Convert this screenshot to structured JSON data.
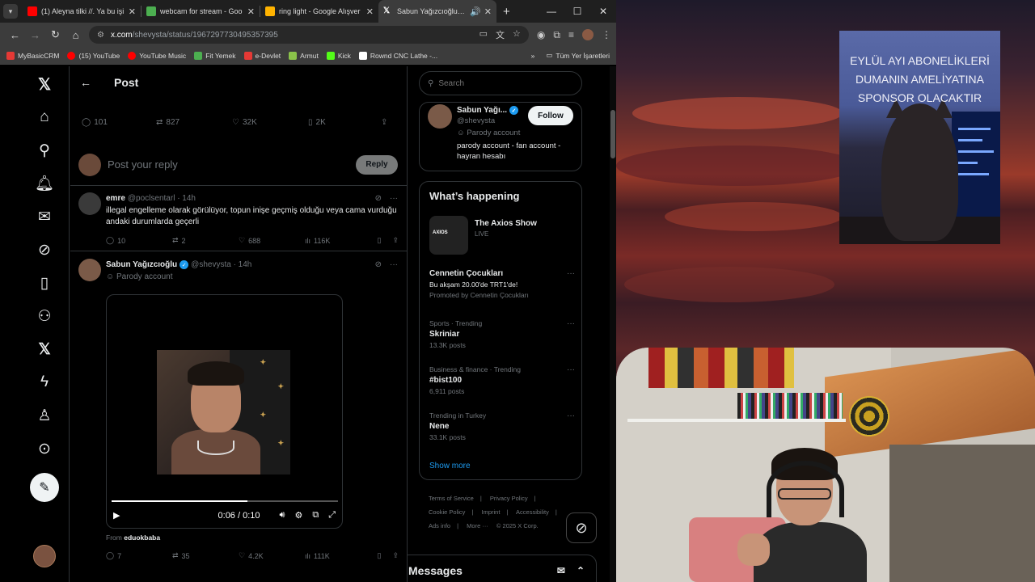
{
  "tabs": [
    {
      "title": "(1) Aleyna tilki //. Ya bu işi",
      "color": "#ff0000",
      "active": false
    },
    {
      "title": "webcam for stream - Goo",
      "color": "#4caf50",
      "active": false
    },
    {
      "title": "ring light - Google Alışver",
      "color": "#ffb300",
      "active": false
    },
    {
      "title": "Sabun Yağızcıoğlu on",
      "color": "#ffffff",
      "active": true
    }
  ],
  "address": {
    "domain": "x.com",
    "path": "/shevysta/status/1967297730495357395"
  },
  "bookmarks": [
    {
      "label": "MyBasicCRM",
      "color": "#e53935"
    },
    {
      "label": "(15) YouTube",
      "color": "#ff0000"
    },
    {
      "label": "YouTube Music",
      "color": "#ff0000"
    },
    {
      "label": "Fit Yemek",
      "color": "#4caf50"
    },
    {
      "label": "e-Devlet",
      "color": "#e53935"
    },
    {
      "label": "Armut",
      "color": "#8bc34a"
    },
    {
      "label": "Kick",
      "color": "#53fc18"
    },
    {
      "label": "Rownd CNC Lathe -...",
      "color": "#ffffff"
    }
  ],
  "bookmarks_all": "Tüm Yer İşaretleri",
  "header": {
    "title": "Post"
  },
  "main_stats": {
    "replies": "101",
    "reposts": "827",
    "likes": "32K",
    "bookmarks": "2K"
  },
  "reply_box": {
    "placeholder": "Post your reply",
    "button": "Reply"
  },
  "tweets": [
    {
      "name": "emre",
      "handle": "@poclsentarl · 14h",
      "text": "illegal engelleme olarak görülüyor, topun inişe geçmiş olduğu veya cama vurduğu andaki durumlarda geçerli",
      "replies": "10",
      "reposts": "2",
      "likes": "688",
      "views": "116K"
    },
    {
      "name": "Sabun Yağızcıoğlu",
      "handle": "@shevysta · 14h",
      "sub": "Parody account",
      "video_time": "0:06 / 0:10",
      "video_progress": 0.6,
      "from_label": "From",
      "from_user": "eduokbaba",
      "replies": "7",
      "reposts": "35",
      "likes": "4.2K",
      "views": "111K"
    }
  ],
  "search": {
    "placeholder": "Search"
  },
  "profile": {
    "name": "Sabun Yağı...",
    "handle": "@shevysta",
    "parody": "Parody account",
    "bio": "parody account - fan account - hayran hesabı",
    "follow": "Follow"
  },
  "trends": {
    "title": "What’s happening",
    "axios": {
      "name": "The Axios Show",
      "status": "LIVE",
      "logo": "AXIOS"
    },
    "items": [
      {
        "category": "",
        "name": "Cennetin Çocukları",
        "count": "Bu akşam 20.00'de TRT1'de!",
        "extra": "Promoted by Cennetin Çocukları"
      },
      {
        "category": "Sports · Trending",
        "name": "Skriniar",
        "count": "13.3K posts"
      },
      {
        "category": "Business & finance · Trending",
        "name": "#bist100",
        "count": "6,911 posts"
      },
      {
        "category": "Trending in Turkey",
        "name": "Nene",
        "count": "33.1K posts"
      }
    ],
    "show_more": "Show more"
  },
  "footer": [
    "Terms of Service",
    "|",
    "Privacy Policy",
    "|",
    "Cookie Policy",
    "|",
    "Imprint",
    "|",
    "Accessibility",
    "|",
    "Ads info",
    "|",
    "More ···",
    "© 2025 X Corp."
  ],
  "messages": {
    "title": "Messages"
  },
  "overlay": {
    "banner_text": "EYLÜL AYI ABONELİKLERİ DUMANIN AMELİYATINA SPONSOR OLACAKTIR"
  }
}
